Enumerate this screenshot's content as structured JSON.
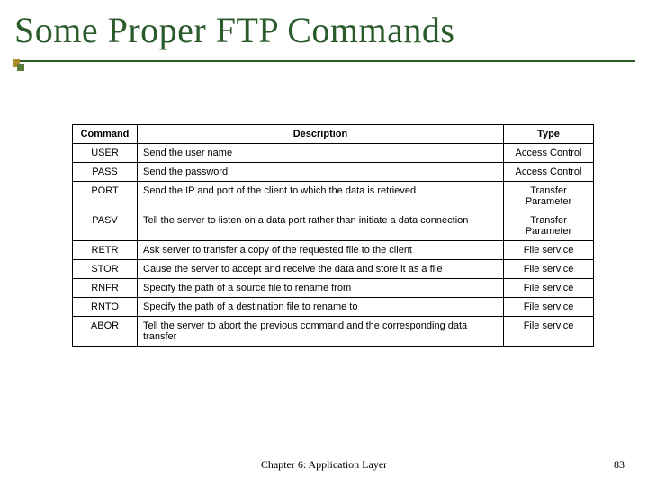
{
  "title": "Some Proper FTP Commands",
  "headers": {
    "c0": "Command",
    "c1": "Description",
    "c2": "Type"
  },
  "rows": [
    {
      "cmd": "USER",
      "desc": "Send the user name",
      "type": "Access Control"
    },
    {
      "cmd": "PASS",
      "desc": "Send the password",
      "type": "Access Control"
    },
    {
      "cmd": "PORT",
      "desc": "Send the IP and port of the client to which the data is retrieved",
      "type": "Transfer Parameter"
    },
    {
      "cmd": "PASV",
      "desc": "Tell the server to listen on a data port rather than initiate a data connection",
      "type": "Transfer Parameter"
    },
    {
      "cmd": "RETR",
      "desc": "Ask server to transfer a copy of the requested file to the client",
      "type": "File service"
    },
    {
      "cmd": "STOR",
      "desc": "Cause the server to accept and receive the data and store it as a file",
      "type": "File service"
    },
    {
      "cmd": "RNFR",
      "desc": "Specify the path of a source file to rename from",
      "type": "File service"
    },
    {
      "cmd": "RNTO",
      "desc": "Specify the path of a destination file to rename to",
      "type": "File service"
    },
    {
      "cmd": "ABOR",
      "desc": "Tell the server to abort the previous command and the corresponding data transfer",
      "type": "File service"
    }
  ],
  "footer": "Chapter 6: Application Layer",
  "page": "83"
}
